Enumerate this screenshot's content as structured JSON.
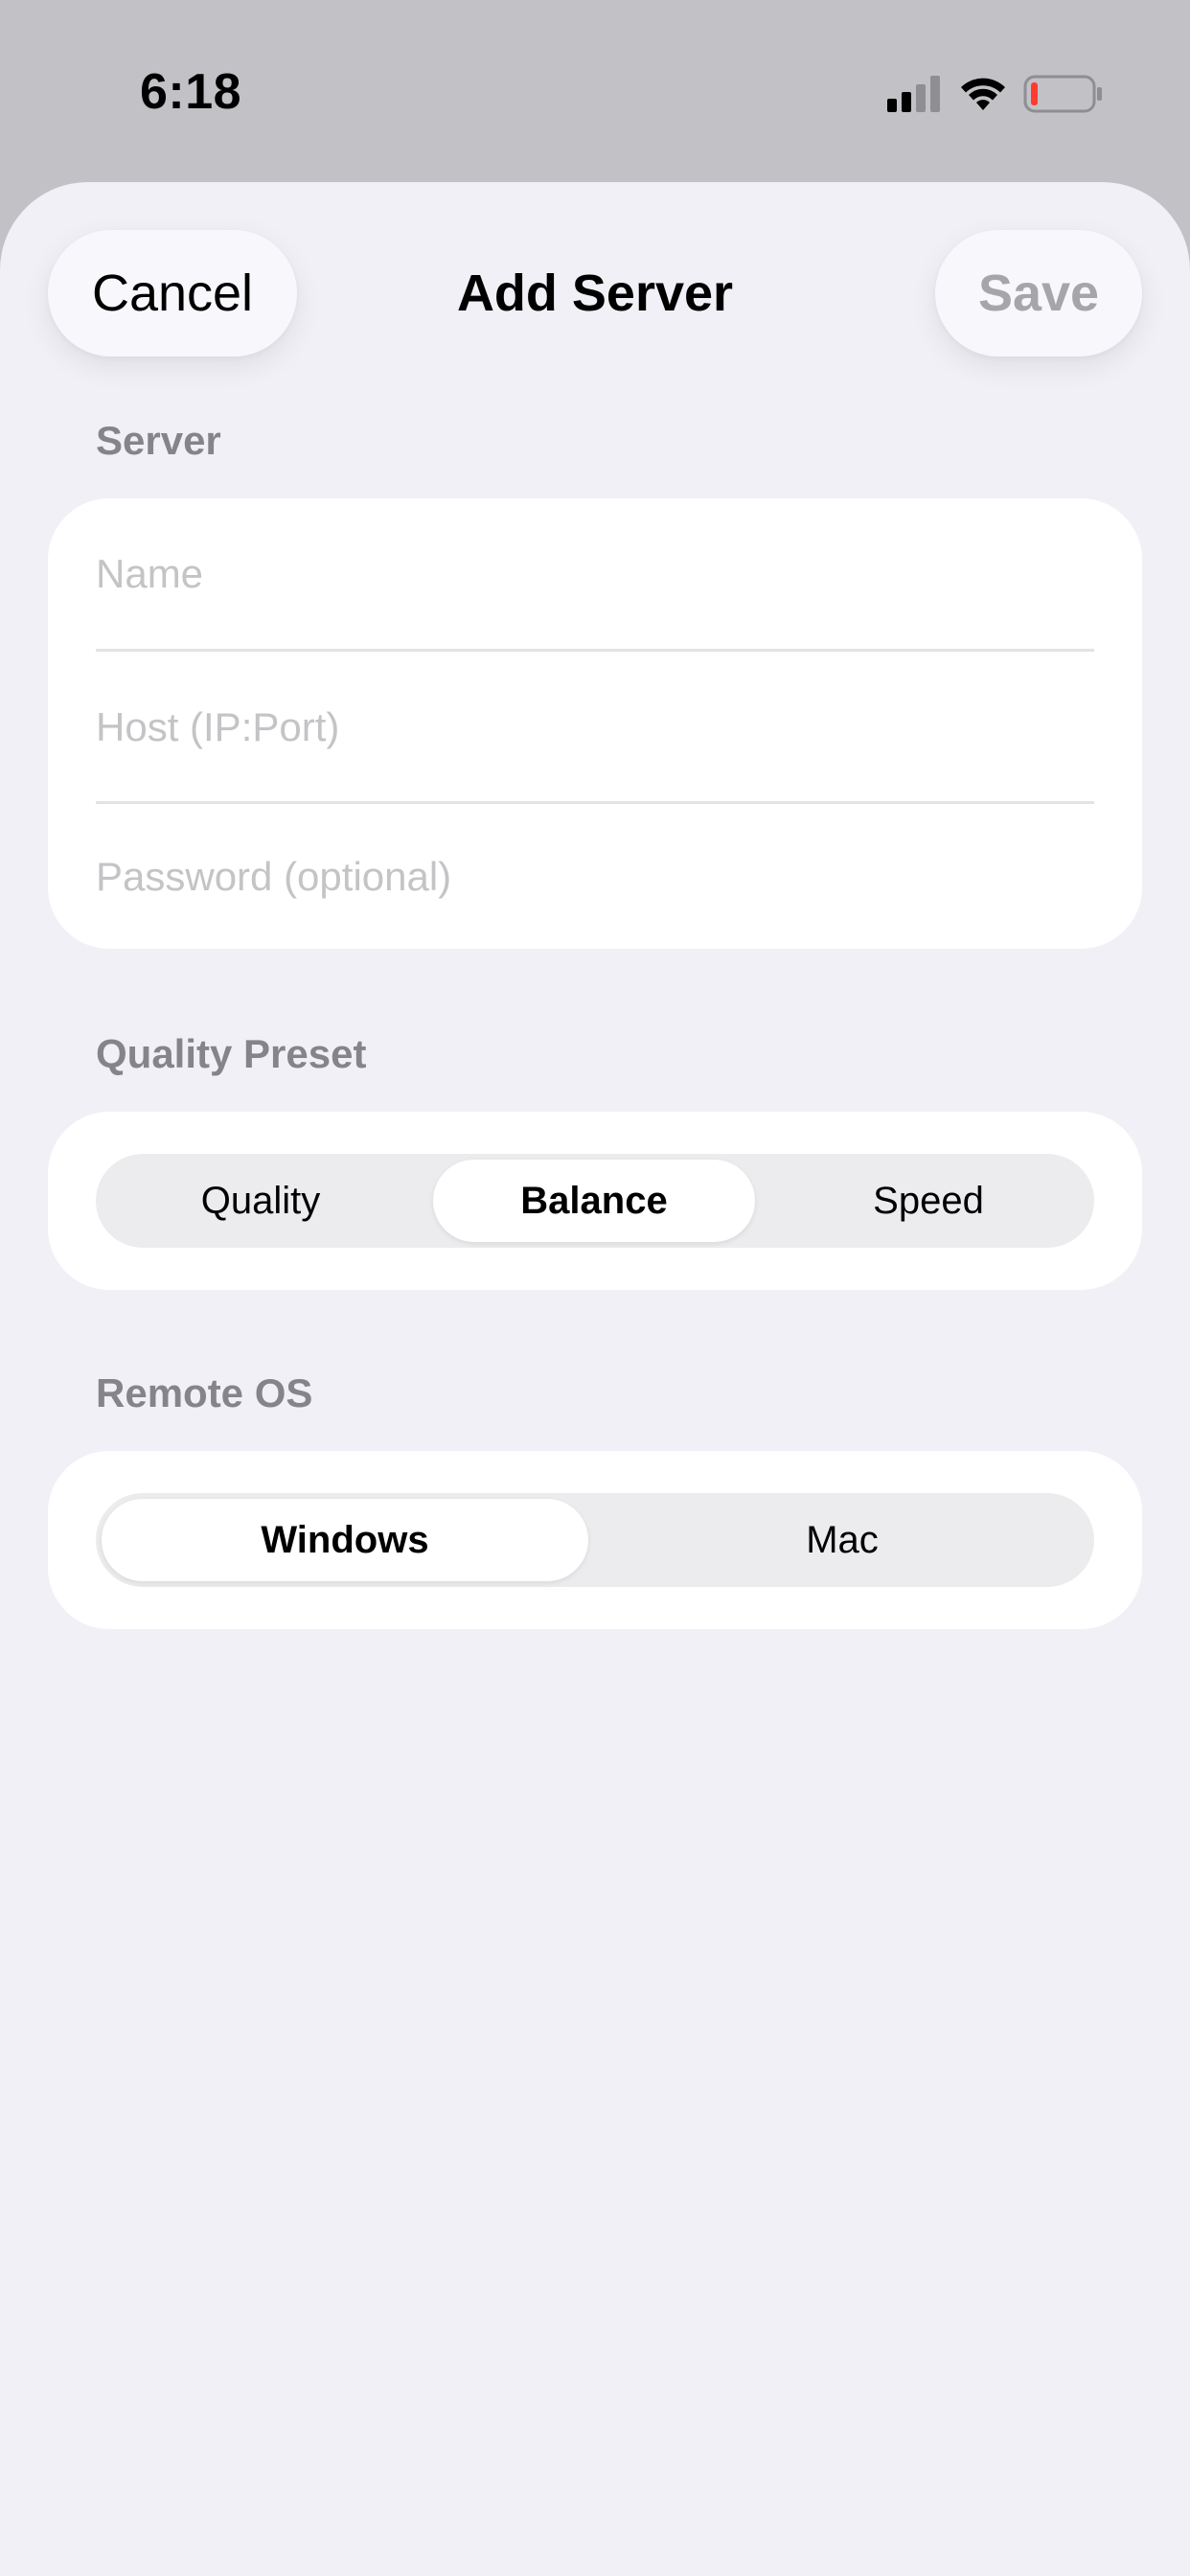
{
  "status_bar": {
    "time": "6:18",
    "icons": [
      "cellular-signal-icon",
      "wifi-icon",
      "battery-low-icon"
    ],
    "battery_level_color": "#ff3b30"
  },
  "nav": {
    "cancel_label": "Cancel",
    "title": "Add Server",
    "save_label": "Save"
  },
  "server_section": {
    "header": "Server",
    "fields": {
      "name": {
        "value": "",
        "placeholder": "Name"
      },
      "host": {
        "value": "",
        "placeholder": "Host (IP:Port)"
      },
      "password": {
        "value": "",
        "placeholder": "Password (optional)"
      }
    }
  },
  "quality_section": {
    "header": "Quality Preset",
    "options": [
      "Quality",
      "Balance",
      "Speed"
    ],
    "selected": "Balance"
  },
  "os_section": {
    "header": "Remote OS",
    "options": [
      "Windows",
      "Mac"
    ],
    "selected": "Windows"
  },
  "colors": {
    "backdrop": "#c2c1c6",
    "sheet_background": "#f1f0f6",
    "card_background": "#ffffff",
    "section_header": "#85848a",
    "disabled_text": "#a6a6aa",
    "placeholder": "#c4c4c7"
  }
}
